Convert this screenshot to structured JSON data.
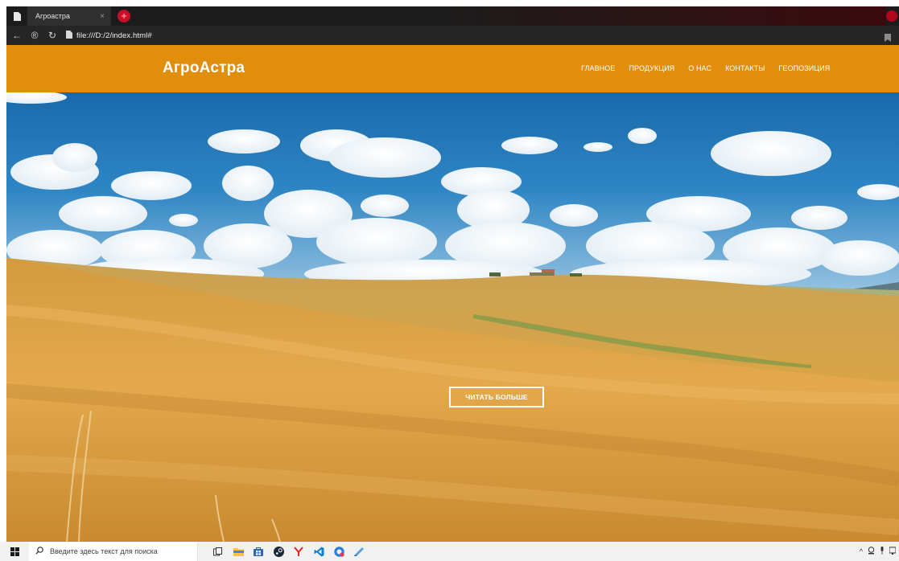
{
  "browser": {
    "tab": {
      "title": "Агроастра",
      "close_glyph": "×"
    },
    "new_tab_glyph": "+",
    "address": {
      "url": "file:///D:/2/index.html#"
    },
    "nav": {
      "back_glyph": "←",
      "info_glyph": "®",
      "reload_glyph": "↻"
    }
  },
  "site": {
    "logo": "АгроАстра",
    "menu": [
      {
        "label": "ГЛАВНОЕ"
      },
      {
        "label": "ПРОДУКЦИЯ"
      },
      {
        "label": "О НАС"
      },
      {
        "label": "КОНТАКТЫ"
      },
      {
        "label": "ГЕОПОЗИЦИЯ"
      }
    ],
    "hero": {
      "button_label": "ЧИТАТЬ БОЛЬШЕ"
    },
    "colors": {
      "header": "#e08e0b",
      "sky": "#1f73b3",
      "field": "#dca245"
    }
  },
  "taskbar": {
    "search_placeholder": "Введите здесь текст для поиска",
    "apps": [
      "task-view-icon",
      "file-explorer-icon",
      "store-icon",
      "steam-icon",
      "yandex-browser-icon",
      "vscode-icon",
      "opera-gx-icon",
      "app-icon"
    ],
    "tray_chevron": "^"
  }
}
